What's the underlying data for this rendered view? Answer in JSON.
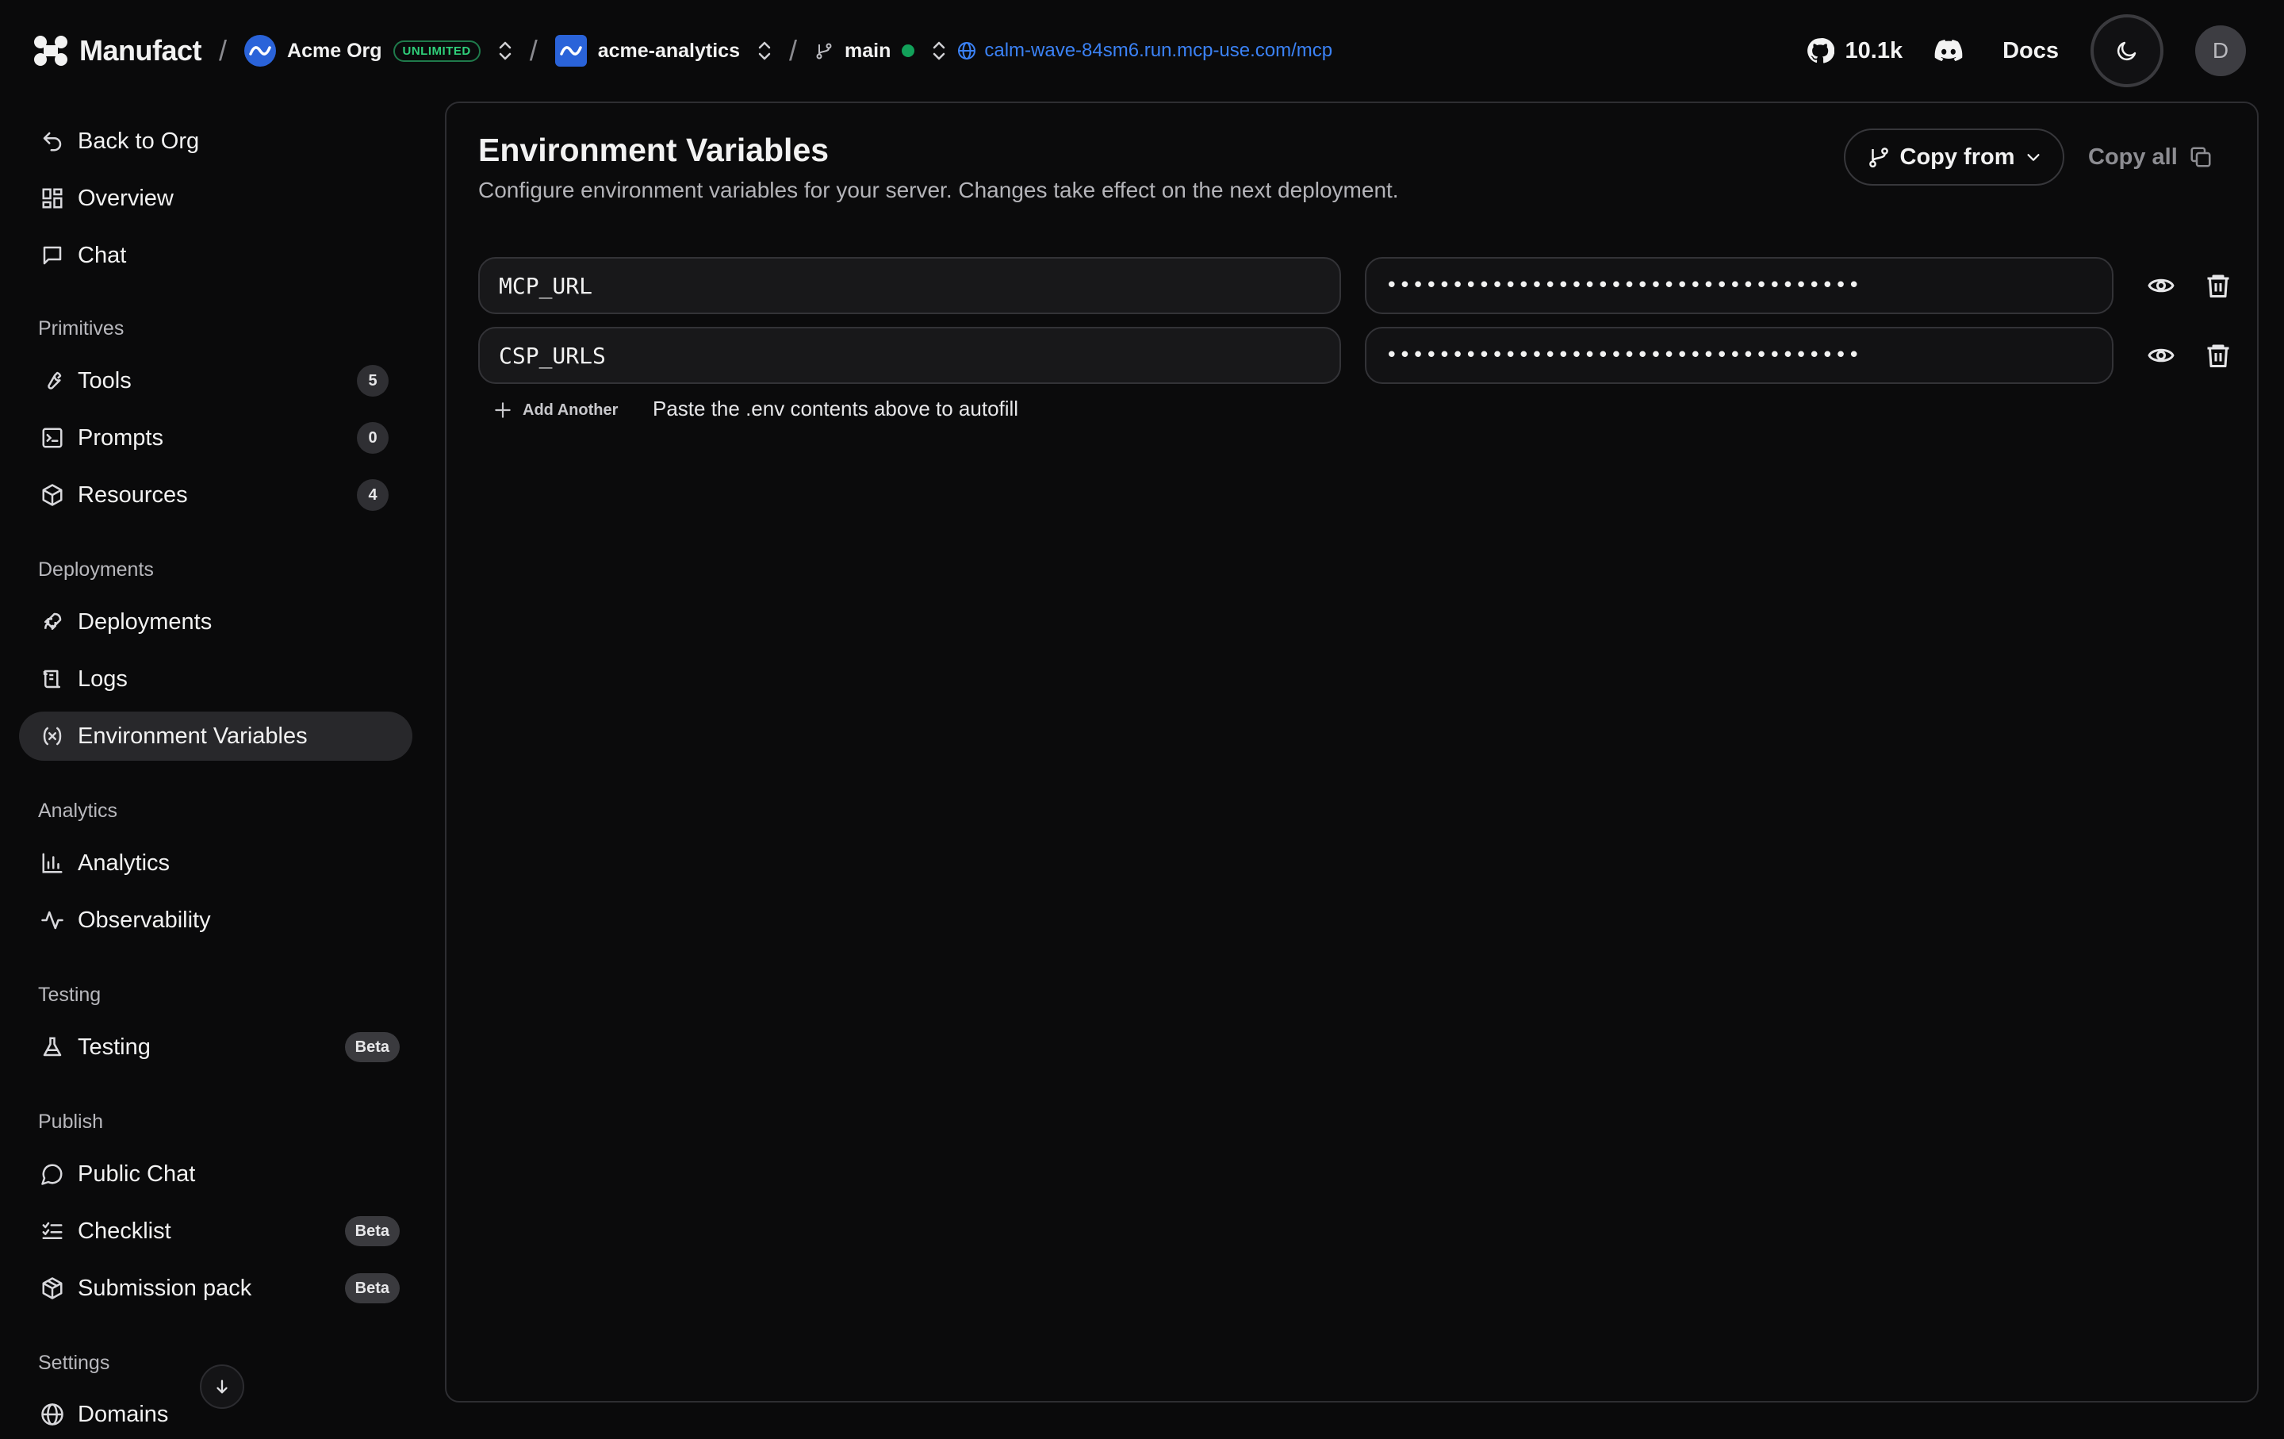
{
  "header": {
    "brand": "Manufact",
    "org_name": "Acme Org",
    "org_badge": "UNLIMITED",
    "project_name": "acme-analytics",
    "branch": "main",
    "server_url": "calm-wave-84sm6.run.mcp-use.com/mcp",
    "github_stars": "10.1k",
    "docs_label": "Docs",
    "user_initial": "D",
    "colors": {
      "accent_blue": "#3b82f6",
      "status_green": "#12a15a",
      "badge_green": "#2fcf7a"
    }
  },
  "sidebar": {
    "back": "Back to Org",
    "overview": "Overview",
    "chat": "Chat",
    "primitives_title": "Primitives",
    "tools": {
      "label": "Tools",
      "count": "5"
    },
    "prompts": {
      "label": "Prompts",
      "count": "0"
    },
    "resources": {
      "label": "Resources",
      "count": "4"
    },
    "deployments_title": "Deployments",
    "deployments": "Deployments",
    "logs": "Logs",
    "env_vars": "Environment Variables",
    "analytics_title": "Analytics",
    "analytics": "Analytics",
    "observability": "Observability",
    "testing_title": "Testing",
    "testing": {
      "label": "Testing",
      "badge": "Beta"
    },
    "publish_title": "Publish",
    "public_chat": "Public Chat",
    "checklist": {
      "label": "Checklist",
      "badge": "Beta"
    },
    "submission_pack": {
      "label": "Submission pack",
      "badge": "Beta"
    },
    "settings_title": "Settings",
    "domains": "Domains"
  },
  "main": {
    "title": "Environment Variables",
    "subtitle": "Configure environment variables for your server. Changes take effect on the next deployment.",
    "copy_from": "Copy from",
    "copy_all": "Copy all",
    "rows": [
      {
        "key": "MCP_URL",
        "value_masked": "••••••••••••••••••••••••••••••••••••"
      },
      {
        "key": "CSP_URLS",
        "value_masked": "••••••••••••••••••••••••••••••••••••"
      }
    ],
    "add_another": "Add Another",
    "paste_hint": "Paste the .env contents above to autofill"
  }
}
